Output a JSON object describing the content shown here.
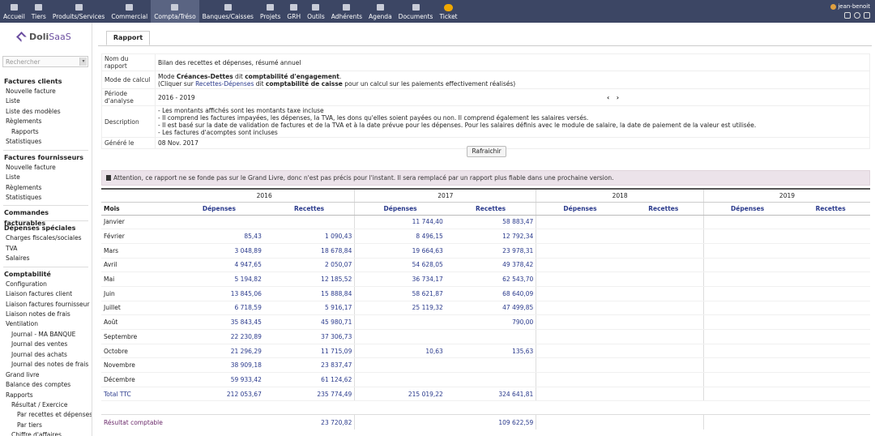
{
  "topmenu": [
    {
      "label": "Accueil",
      "icon": "home-icon",
      "active": false
    },
    {
      "label": "Tiers",
      "icon": "building-icon",
      "active": false
    },
    {
      "label": "Produits/Services",
      "icon": "cube-icon",
      "active": false
    },
    {
      "label": "Commercial",
      "icon": "briefcase-icon",
      "active": false
    },
    {
      "label": "Compta/Tréso",
      "icon": "money-icon",
      "active": true
    },
    {
      "label": "Banques/Caisses",
      "icon": "bank-icon",
      "active": false
    },
    {
      "label": "Projets",
      "icon": "sitemap-icon",
      "active": false
    },
    {
      "label": "GRH",
      "icon": "hand-icon",
      "active": false
    },
    {
      "label": "Outils",
      "icon": "tools-icon",
      "active": false
    },
    {
      "label": "Adhérents",
      "icon": "users-icon",
      "active": false
    },
    {
      "label": "Agenda",
      "icon": "calendar-icon",
      "active": false
    },
    {
      "label": "Documents",
      "icon": "folder-icon",
      "active": false
    },
    {
      "label": "Ticket",
      "icon": "ticket-icon",
      "active": false
    }
  ],
  "user": {
    "name": "jean-benoit"
  },
  "logo": {
    "part1": "Doli",
    "part2": "SaaS"
  },
  "search": {
    "placeholder": "Rechercher"
  },
  "sidebar": [
    {
      "type": "head",
      "label": "Factures clients"
    },
    {
      "type": "item",
      "label": "Nouvelle facture",
      "level": 1
    },
    {
      "type": "item",
      "label": "Liste",
      "level": 1
    },
    {
      "type": "item",
      "label": "Liste des modèles",
      "level": 1
    },
    {
      "type": "item",
      "label": "Règlements",
      "level": 1
    },
    {
      "type": "item",
      "label": "Rapports",
      "level": 2
    },
    {
      "type": "item",
      "label": "Statistiques",
      "level": 1
    },
    {
      "type": "sep"
    },
    {
      "type": "head",
      "label": "Factures fournisseurs"
    },
    {
      "type": "item",
      "label": "Nouvelle facture",
      "level": 1
    },
    {
      "type": "item",
      "label": "Liste",
      "level": 1
    },
    {
      "type": "item",
      "label": "Règlements",
      "level": 1
    },
    {
      "type": "item",
      "label": "Statistiques",
      "level": 1
    },
    {
      "type": "sep"
    },
    {
      "type": "head",
      "label": "Commandes facturables"
    },
    {
      "type": "sep"
    },
    {
      "type": "head",
      "label": "Dépenses spéciales"
    },
    {
      "type": "item",
      "label": "Charges fiscales/sociales",
      "level": 1
    },
    {
      "type": "item",
      "label": "TVA",
      "level": 1
    },
    {
      "type": "item",
      "label": "Salaires",
      "level": 1
    },
    {
      "type": "sep"
    },
    {
      "type": "head",
      "label": "Comptabilité"
    },
    {
      "type": "item",
      "label": "Configuration",
      "level": 1
    },
    {
      "type": "item",
      "label": "Liaison factures client",
      "level": 1
    },
    {
      "type": "item",
      "label": "Liaison factures fournisseur",
      "level": 1
    },
    {
      "type": "item",
      "label": "Liaison notes de frais",
      "level": 1
    },
    {
      "type": "item",
      "label": "Ventilation",
      "level": 1
    },
    {
      "type": "item",
      "label": "Journal - MA BANQUE",
      "level": 2
    },
    {
      "type": "item",
      "label": "Journal des ventes",
      "level": 2
    },
    {
      "type": "item",
      "label": "Journal des achats",
      "level": 2
    },
    {
      "type": "item",
      "label": "Journal des notes de frais",
      "level": 2
    },
    {
      "type": "item",
      "label": "Grand livre",
      "level": 1
    },
    {
      "type": "item",
      "label": "Balance des comptes",
      "level": 1
    },
    {
      "type": "item",
      "label": "Rapports",
      "level": 1
    },
    {
      "type": "item",
      "label": "Résultat / Exercice",
      "level": 2
    },
    {
      "type": "item",
      "label": "Par recettes et dépenses",
      "level": 3
    },
    {
      "type": "item",
      "label": "Par tiers",
      "level": 3
    },
    {
      "type": "item",
      "label": "Chiffre d'affaires",
      "level": 2
    }
  ],
  "tab": {
    "label": "Rapport"
  },
  "report": {
    "name_label": "Nom du rapport",
    "name_value": "Bilan des recettes et dépenses, résumé annuel",
    "mode_label": "Mode de calcul",
    "mode_l1_a": "Mode ",
    "mode_l1_b": "Créances-Dettes",
    "mode_l1_c": " dit ",
    "mode_l1_d": "comptabilité d'engagement",
    "mode_l1_e": ".",
    "mode_l2_a": "(Cliquer sur ",
    "mode_l2_link": "Recettes-Dépenses",
    "mode_l2_b": " dit ",
    "mode_l2_c": "comptabilité de caisse",
    "mode_l2_d": " pour un calcul sur les paiements effectivement réalisés)",
    "period_label": "Période d'analyse",
    "period_value": "2016 - 2019",
    "prev_arrow": "‹",
    "next_arrow": "›",
    "desc_label": "Description",
    "desc_lines": [
      "- Les montants affichés sont les montants taxe incluse",
      "- Il comprend les factures impayées, les dépenses, la TVA, les dons qu'elles soient payées ou non. Il comprend également les salaires versés.",
      "- Il est basé sur la date de validation de factures et de la TVA et à la date prévue pour les dépenses. Pour les salaires définis avec le module de salaire, la date de paiement de la valeur est utilisée.",
      "- Les factures d'acomptes sont incluses"
    ],
    "generated_label": "Généré le",
    "generated_value": "08 Nov. 2017"
  },
  "refresh_label": "Rafraichir",
  "warning": "Attention, ce rapport ne se fonde pas sur le Grand Livre, donc n'est pas précis pour l'instant. Il sera remplacé par un rapport plus fiable dans une prochaine version.",
  "table": {
    "years": [
      "2016",
      "2017",
      "2018",
      "2019"
    ],
    "month_header": "Mois",
    "dep_header": "Dépenses",
    "rec_header": "Recettes",
    "rows": [
      {
        "month": "Janvier",
        "v": [
          "",
          "",
          "11 744,40",
          "58 883,47",
          "",
          "",
          "",
          ""
        ]
      },
      {
        "month": "Février",
        "v": [
          "85,43",
          "1 090,43",
          "8 496,15",
          "12 792,34",
          "",
          "",
          "",
          ""
        ]
      },
      {
        "month": "Mars",
        "v": [
          "3 048,89",
          "18 678,84",
          "19 664,63",
          "23 978,31",
          "",
          "",
          "",
          ""
        ]
      },
      {
        "month": "Avril",
        "v": [
          "4 947,65",
          "2 050,07",
          "54 628,05",
          "49 378,42",
          "",
          "",
          "",
          ""
        ]
      },
      {
        "month": "Mai",
        "v": [
          "5 194,82",
          "12 185,52",
          "36 734,17",
          "62 543,70",
          "",
          "",
          "",
          ""
        ]
      },
      {
        "month": "Juin",
        "v": [
          "13 845,06",
          "15 888,84",
          "58 621,87",
          "68 640,09",
          "",
          "",
          "",
          ""
        ]
      },
      {
        "month": "Juillet",
        "v": [
          "6 718,59",
          "5 916,17",
          "25 119,32",
          "47 499,85",
          "",
          "",
          "",
          ""
        ]
      },
      {
        "month": "Août",
        "v": [
          "35 843,45",
          "45 980,71",
          "",
          "790,00",
          "",
          "",
          "",
          ""
        ]
      },
      {
        "month": "Septembre",
        "v": [
          "22 230,89",
          "37 306,73",
          "",
          "",
          "",
          "",
          "",
          ""
        ]
      },
      {
        "month": "Octobre",
        "v": [
          "21 296,29",
          "11 715,09",
          "10,63",
          "135,63",
          "",
          "",
          "",
          ""
        ]
      },
      {
        "month": "Novembre",
        "v": [
          "38 909,18",
          "23 837,47",
          "",
          "",
          "",
          "",
          "",
          ""
        ]
      },
      {
        "month": "Décembre",
        "v": [
          "59 933,42",
          "61 124,62",
          "",
          "",
          "",
          "",
          "",
          ""
        ]
      }
    ],
    "total_label": "Total TTC",
    "total": [
      "212 053,67",
      "235 774,49",
      "215 019,22",
      "324 641,81",
      "",
      "",
      "",
      ""
    ],
    "result_label": "Résultat comptable",
    "result": [
      "",
      "23 720,82",
      "",
      "109 622,59",
      "",
      "",
      "",
      ""
    ]
  }
}
